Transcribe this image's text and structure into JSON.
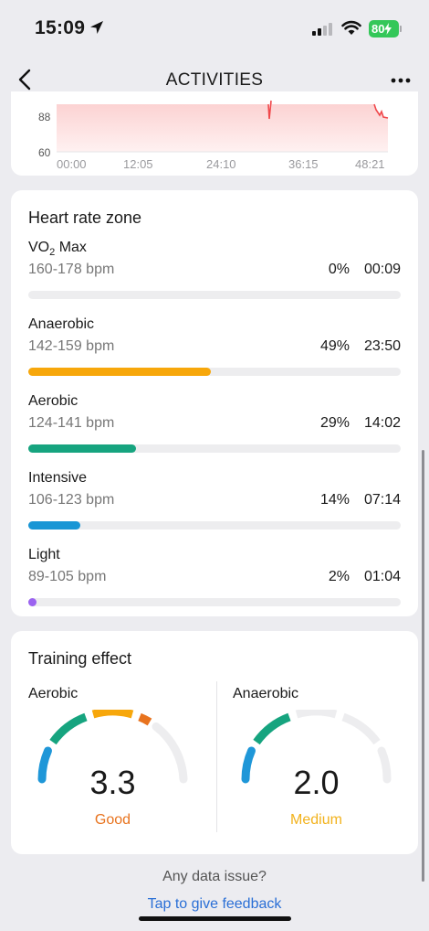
{
  "status_bar": {
    "time": "15:09",
    "battery": "80"
  },
  "nav": {
    "title": "ACTIVITIES",
    "back_icon": "chevron-left-icon",
    "more_icon": "ellipsis-icon"
  },
  "hr_chart": {
    "y_ticks": [
      "88",
      "60"
    ],
    "x_ticks": [
      "00:00",
      "12:05",
      "24:10",
      "36:15",
      "48:21"
    ],
    "line_color": "#f0484b",
    "fill_color": "#fde0e0"
  },
  "zones_card": {
    "title": "Heart rate zone",
    "zones": [
      {
        "name_prefix": "VO",
        "name_sub": "2",
        "name_suffix": " Max",
        "range": "160-178 bpm",
        "percent": "0%",
        "time": "00:09",
        "fraction": 0.0,
        "color": "#ededef"
      },
      {
        "name": "Anaerobic",
        "range": "142-159 bpm",
        "percent": "49%",
        "time": "23:50",
        "fraction": 0.49,
        "color": "#f7a70b"
      },
      {
        "name": "Aerobic",
        "range": "124-141 bpm",
        "percent": "29%",
        "time": "14:02",
        "fraction": 0.29,
        "color": "#16a47f"
      },
      {
        "name": "Intensive",
        "range": "106-123 bpm",
        "percent": "14%",
        "time": "07:14",
        "fraction": 0.14,
        "color": "#1996d5"
      },
      {
        "name": "Light",
        "range": "89-105 bpm",
        "percent": "2%",
        "time": "01:04",
        "fraction": 0.02,
        "color": "#9b63f0"
      }
    ]
  },
  "training_effect": {
    "title": "Training effect",
    "aerobic": {
      "label": "Aerobic",
      "value": "3.3",
      "grade": "Good",
      "grade_color": "#e8731e"
    },
    "anaerobic": {
      "label": "Anaerobic",
      "value": "2.0",
      "grade": "Medium",
      "grade_color": "#f2b21c"
    }
  },
  "footer": {
    "question": "Any data issue?",
    "link": "Tap to give feedback"
  }
}
